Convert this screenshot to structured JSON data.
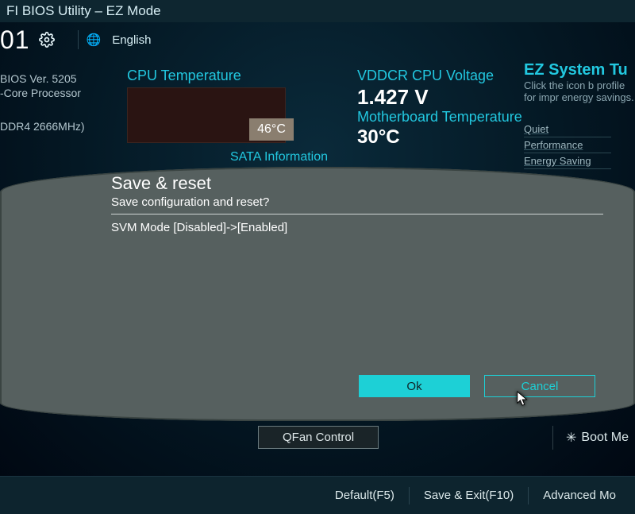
{
  "header": {
    "title": "FI BIOS Utility – EZ Mode",
    "clock": "01",
    "language": "English"
  },
  "sysinfo": {
    "bios_ver": "BIOS Ver. 5205",
    "processor": "-Core Processor",
    "memory": "DDR4 2666MHz)"
  },
  "status": {
    "cpu_temp_label": "CPU Temperature",
    "cpu_temp_val": "46°C",
    "vdd_label": "VDDCR CPU Voltage",
    "vdd_val": "1.427 V",
    "mb_temp_label": "Motherboard Temperature",
    "mb_temp_val": "30°C",
    "sata_label": "SATA Information"
  },
  "ez": {
    "title": "EZ System Tu",
    "desc": "Click the icon b\nprofile for impr\nenergy savings.",
    "profiles": [
      "Quiet",
      "Performance",
      "Energy Saving"
    ]
  },
  "modal": {
    "title": "Save & reset",
    "subtitle": "Save configuration and reset?",
    "change": "SVM Mode [Disabled]->[Enabled]",
    "ok": "Ok",
    "cancel": "Cancel"
  },
  "bottom": {
    "qfan": "QFan Control",
    "boot_menu": "Boot Me",
    "default": "Default(F5)",
    "save_exit": "Save & Exit(F10)",
    "advanced": "Advanced Mo"
  }
}
